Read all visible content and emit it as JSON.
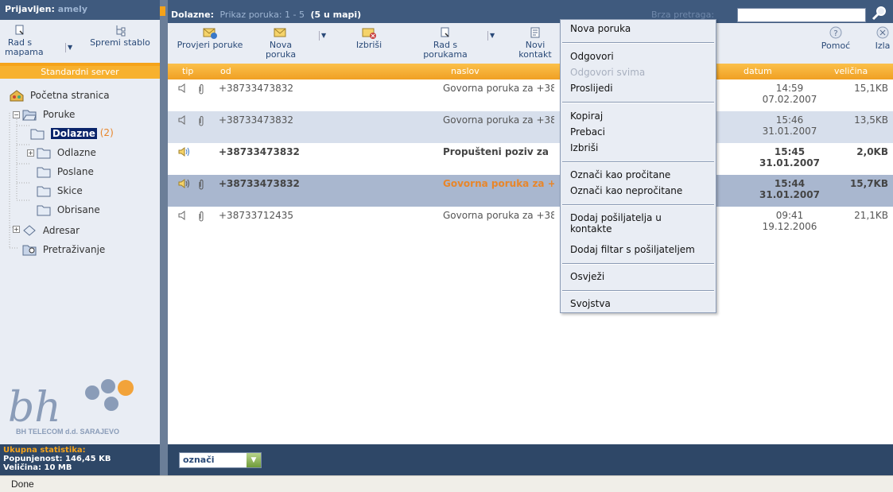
{
  "left": {
    "logged_in_label": "Prijavljen:",
    "user": "amely",
    "tools": {
      "folders_work": "Rad s\nmapama",
      "save_tree": "Spremi stablo"
    },
    "server": "Standardni server",
    "tree": {
      "home": "Početna stranica",
      "messages": "Poruke",
      "inbox": "Dolazne",
      "inbox_count": "(2)",
      "outbox": "Odlazne",
      "sent": "Poslane",
      "drafts": "Skice",
      "deleted": "Obrisane",
      "addressbook": "Adresar",
      "search": "Pretraživanje"
    },
    "logo_text": "bh",
    "company": "BH TELECOM d.d. SARAJEVO",
    "stats": {
      "title": "Ukupna statistika:",
      "occupancy": "Popunjenost: 146,45 KB",
      "size": "Veličina: 10 MB"
    }
  },
  "topbar": {
    "folder_label": "Dolazne:",
    "showing": "Prikaz poruka: 1 - 5",
    "in_folder": "(5 u mapi)",
    "quick_search": "Brza pretraga:",
    "quick_search_value": ""
  },
  "toolbar": {
    "check": "Provjeri poruke",
    "new": "Nova\nporuka",
    "delete": "Izbriši",
    "msg_work": "Rad s\nporukama",
    "new_contact": "Novi\nkontakt",
    "help": "Pomoć",
    "logout": "Izla"
  },
  "columns": {
    "tip": "tip",
    "from": "od",
    "subject": "naslov",
    "date": "datum",
    "size": "veličina"
  },
  "messages": [
    {
      "from": "+38733473832",
      "subject": "Govorna poruka za +38",
      "time": "14:59",
      "date": "07.02.2007",
      "size": "15,1KB",
      "bold": false
    },
    {
      "from": "+38733473832",
      "subject": "Govorna poruka za +38",
      "time": "15:46",
      "date": "31.01.2007",
      "size": "13,5KB",
      "bold": false
    },
    {
      "from": "+38733473832",
      "subject": "Propušteni poziv za",
      "time": "15:45",
      "date": "31.01.2007",
      "size": "2,0KB",
      "bold": true
    },
    {
      "from": "+38733473832",
      "subject": "Govorna poruka za +",
      "time": "15:44",
      "date": "31.01.2007",
      "size": "15,7KB",
      "bold": true
    },
    {
      "from": "+38733712435",
      "subject": "Govorna poruka za +38",
      "time": "09:41",
      "date": "19.12.2006",
      "size": "21,1KB",
      "bold": false
    }
  ],
  "footer": {
    "mark": "označi"
  },
  "context_menu": {
    "new_message": "Nova poruka",
    "reply": "Odgovori",
    "reply_all": "Odgovori svima",
    "forward": "Proslijedi",
    "copy": "Kopiraj",
    "move": "Prebaci",
    "delete": "Izbriši",
    "mark_read": "Označi kao pročitane",
    "mark_unread": "Označi kao nepročitane",
    "add_sender_1": "Dodaj pošiljatelja u",
    "add_sender_2": "kontakte",
    "add_filter": "Dodaj filtar s pošiljateljem",
    "refresh": "Osvježi",
    "properties": "Svojstva"
  },
  "status": "Done",
  "colors": {
    "navy": "#3f5a7e",
    "orange": "#f5a31a",
    "panel": "#e9edf4"
  }
}
